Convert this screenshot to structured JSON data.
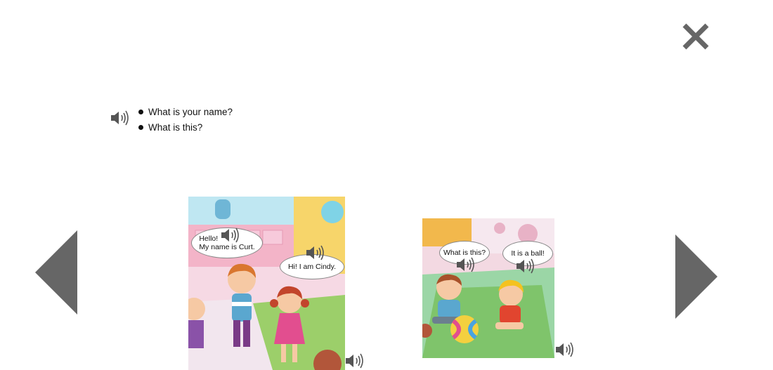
{
  "controls": {
    "close_icon": "close-icon",
    "prev_icon": "arrow-left-icon",
    "next_icon": "arrow-right-icon",
    "icon_color": "#666666"
  },
  "questions": {
    "audio_icon": "speaker-icon",
    "items": [
      "What is your name?",
      "What is this?"
    ]
  },
  "scene1": {
    "bubble1_line1": "Hello!",
    "bubble1_line2": "My name is Curt.",
    "bubble2": "Hi! I am Cindy."
  },
  "scene2": {
    "bubble1": "What is this?",
    "bubble2": "It is a ball!"
  }
}
